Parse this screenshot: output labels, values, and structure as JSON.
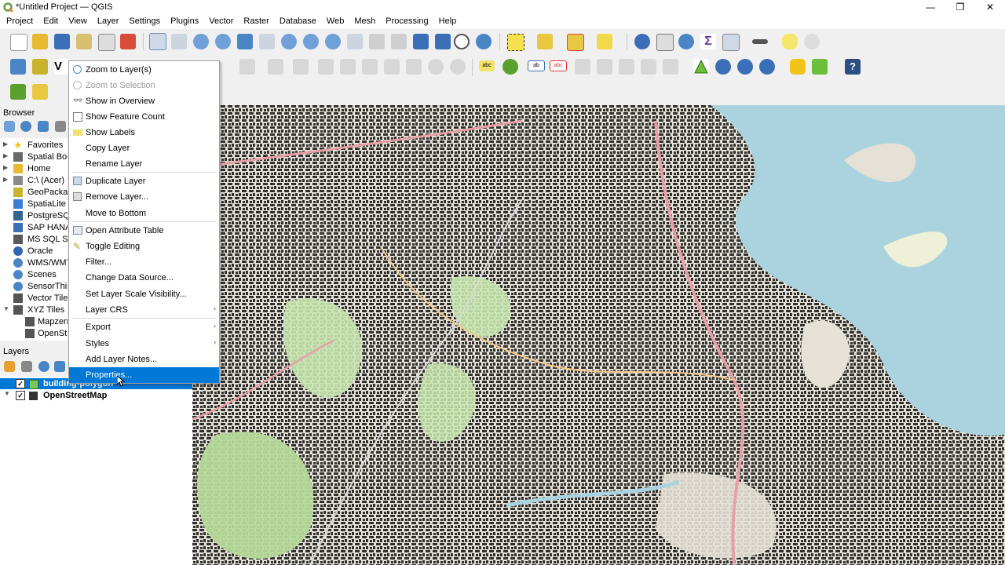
{
  "window": {
    "title": "*Untitled Project — QGIS",
    "min": "—",
    "max": "❐",
    "close": "✕"
  },
  "menubar": [
    "Project",
    "Edit",
    "View",
    "Layer",
    "Settings",
    "Plugins",
    "Vector",
    "Raster",
    "Database",
    "Web",
    "Mesh",
    "Processing",
    "Help"
  ],
  "browser": {
    "title": "Browser",
    "items": [
      {
        "label": "Favorites",
        "icon": "star-icon",
        "color": "#f2c418"
      },
      {
        "label": "Spatial Bookmarks",
        "icon": "bookmark-icon",
        "color": "#6a6a6a"
      },
      {
        "label": "Home",
        "icon": "folder-icon",
        "color": "#e8b931"
      },
      {
        "label": "C:\\ (Acer)",
        "icon": "drive-icon",
        "color": "#8a8a8a"
      },
      {
        "label": "GeoPackage",
        "icon": "geopackage-icon",
        "color": "#c7b42c"
      },
      {
        "label": "SpatiaLite",
        "icon": "spatialite-icon",
        "color": "#3b7dd8"
      },
      {
        "label": "PostgreSQL",
        "icon": "postgresql-icon",
        "color": "#336791"
      },
      {
        "label": "SAP HANA",
        "icon": "sap-hana-icon",
        "color": "#3a6fb7"
      },
      {
        "label": "MS SQL Server",
        "icon": "mssql-icon",
        "color": "#5a5a5a"
      },
      {
        "label": "Oracle",
        "icon": "oracle-icon",
        "color": "#2f67b2"
      },
      {
        "label": "WMS/WMTS",
        "icon": "wms-icon",
        "color": "#4a86c5"
      },
      {
        "label": "Scenes",
        "icon": "scenes-icon",
        "color": "#4a86c5"
      },
      {
        "label": "SensorThings",
        "icon": "sensorthings-icon",
        "color": "#4a86c5"
      },
      {
        "label": "Vector Tiles",
        "icon": "vector-tiles-icon",
        "color": "#555555"
      },
      {
        "label": "XYZ Tiles",
        "icon": "xyz-tiles-icon",
        "color": "#555555"
      },
      {
        "label": "Mapzen Global Terrain",
        "icon": "tile-icon",
        "color": "#555555"
      },
      {
        "label": "OpenStreetMap",
        "icon": "tile-icon",
        "color": "#555555"
      }
    ]
  },
  "layers": {
    "title": "Layers",
    "items": [
      {
        "label": "building-polygon",
        "checked": "✓",
        "selected": true
      },
      {
        "label": "OpenStreetMap",
        "checked": "✓",
        "selected": false
      }
    ]
  },
  "context_menu": {
    "items": [
      {
        "label": "Zoom to Layer(s)",
        "icon": "zoom-layer-icon",
        "disabled": false
      },
      {
        "label": "Zoom to Selection",
        "icon": "zoom-selection-icon",
        "disabled": true
      },
      {
        "label": "Show in Overview",
        "icon": "overview-icon",
        "disabled": false
      },
      {
        "label": "Show Feature Count",
        "icon": "checkbox-icon",
        "disabled": false
      },
      {
        "label": "Show Labels",
        "icon": "labels-icon",
        "disabled": false
      },
      {
        "label": "Copy Layer",
        "icon": "",
        "disabled": false
      },
      {
        "label": "Rename Layer",
        "icon": "",
        "disabled": false
      },
      {
        "label": "Duplicate Layer",
        "icon": "duplicate-icon",
        "disabled": false
      },
      {
        "label": "Remove Layer...",
        "icon": "remove-icon",
        "disabled": false
      },
      {
        "label": "Move to Bottom",
        "icon": "",
        "disabled": false
      },
      {
        "label": "Open Attribute Table",
        "icon": "attribute-table-icon",
        "disabled": false
      },
      {
        "label": "Toggle Editing",
        "icon": "pencil-icon",
        "disabled": false
      },
      {
        "label": "Filter...",
        "icon": "",
        "disabled": false
      },
      {
        "label": "Change Data Source...",
        "icon": "",
        "disabled": false
      },
      {
        "label": "Set Layer Scale Visibility...",
        "icon": "",
        "disabled": false
      },
      {
        "label": "Layer CRS",
        "icon": "",
        "submenu": "›"
      },
      {
        "label": "Export",
        "icon": "",
        "submenu": "›"
      },
      {
        "label": "Styles",
        "icon": "",
        "submenu": "›"
      },
      {
        "label": "Add Layer Notes...",
        "icon": "",
        "disabled": false
      },
      {
        "label": "Properties...",
        "icon": "",
        "highlighted": true
      }
    ]
  },
  "colors": {
    "accent": "#0078d7",
    "map_land": "#e5e1d6",
    "map_water": "#aad3df",
    "map_park": "#c8e6b0",
    "buildings": "#1c1c1c"
  }
}
